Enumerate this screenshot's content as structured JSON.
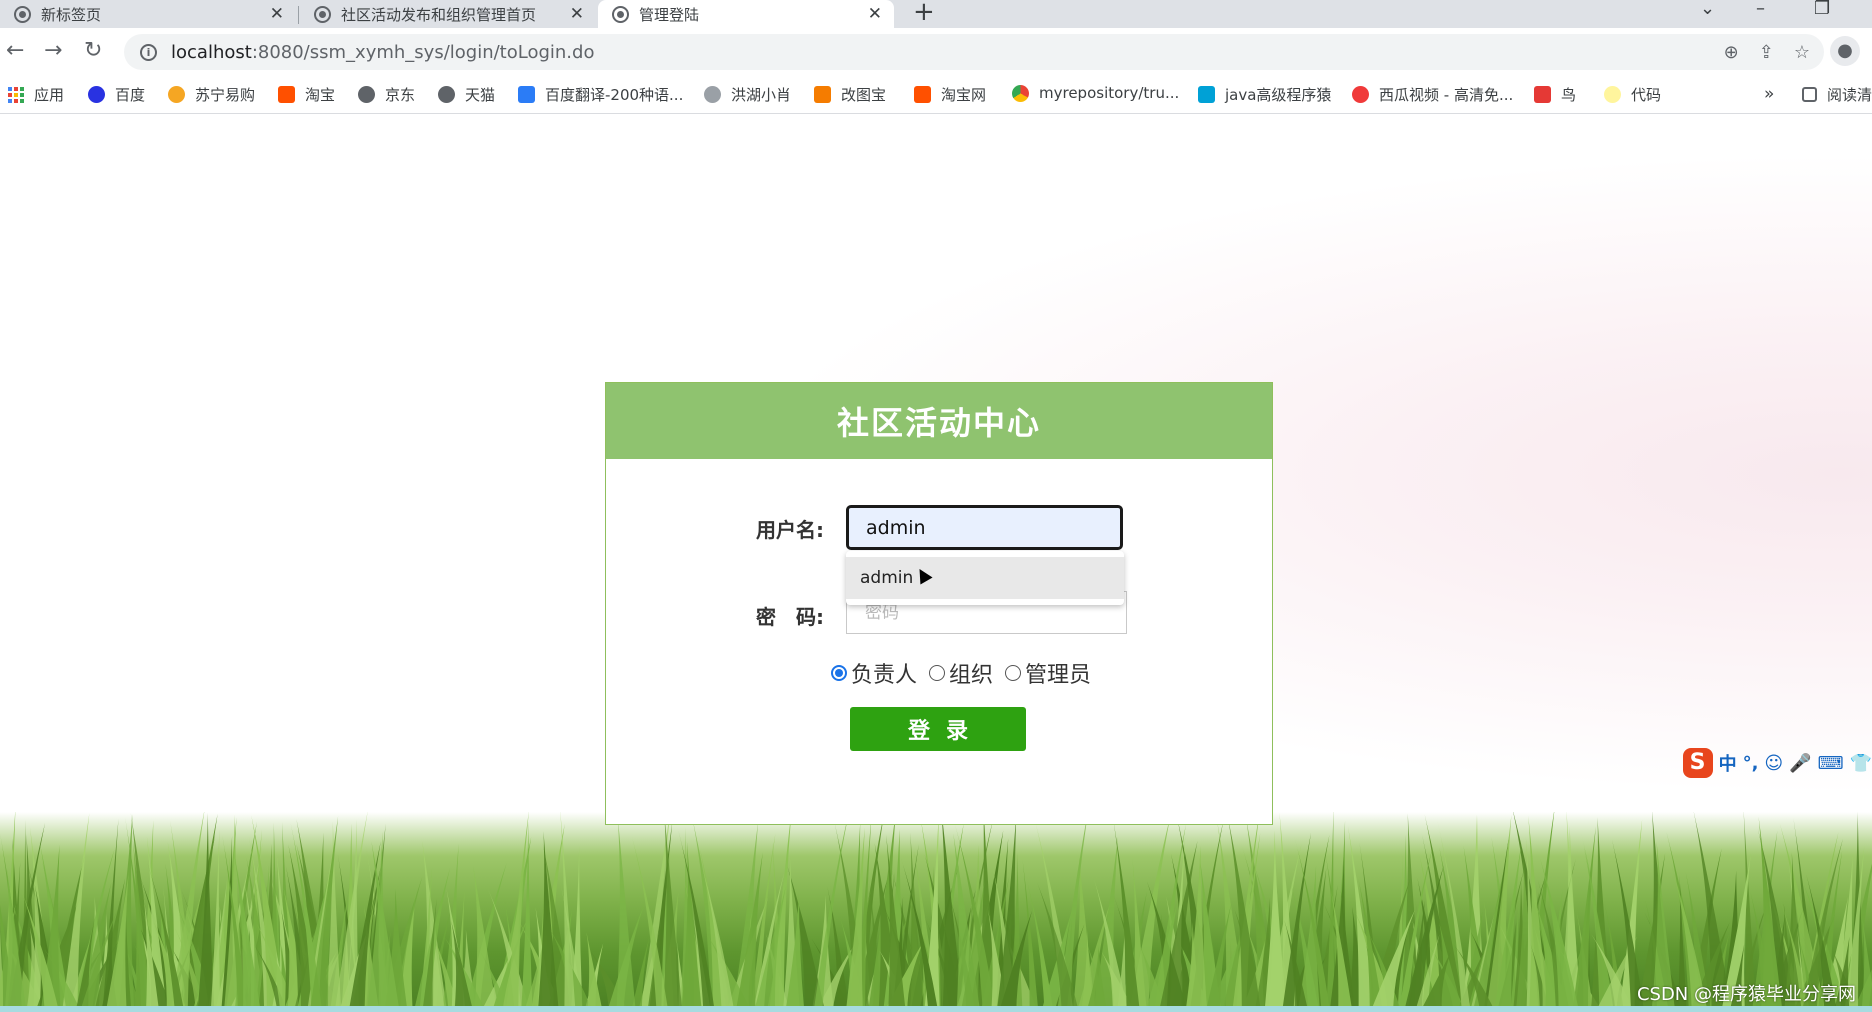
{
  "browser": {
    "tabs": [
      {
        "title": "新标签页",
        "active": false
      },
      {
        "title": "社区活动发布和组织管理首页",
        "active": false
      },
      {
        "title": "管理登陆",
        "active": true
      }
    ],
    "new_tab": "+",
    "url_host": "localhost",
    "url_rest": ":8080/ssm_xymh_sys/login/toLogin.do",
    "bookmarks": [
      {
        "label": "应用",
        "icon": "apps-grid-icon"
      },
      {
        "label": "百度",
        "icon": "baidu-icon"
      },
      {
        "label": "苏宁易购",
        "icon": "suning-icon"
      },
      {
        "label": "淘宝",
        "icon": "taobao-icon"
      },
      {
        "label": "京东",
        "icon": "globe-icon"
      },
      {
        "label": "天猫",
        "icon": "globe-icon"
      },
      {
        "label": "百度翻译-200种语...",
        "icon": "baidu-translate-icon"
      },
      {
        "label": "洪湖小肖",
        "icon": "bird-icon"
      },
      {
        "label": "改图宝",
        "icon": "gaitubao-icon"
      },
      {
        "label": "淘宝网",
        "icon": "taobao-icon"
      },
      {
        "label": "myrepository/tru...",
        "icon": "chrome-icon"
      },
      {
        "label": "java高级程序猿",
        "icon": "bilibili-icon"
      },
      {
        "label": "西瓜视频 - 高清免...",
        "icon": "xigua-icon"
      },
      {
        "label": "鸟",
        "icon": "bird-red-icon"
      },
      {
        "label": "代码",
        "icon": "leaf-icon"
      }
    ],
    "more_bookmarks": "»",
    "reading_list": "阅读清"
  },
  "login": {
    "title": "社区活动中心",
    "username_label": "用户名:",
    "username_value": "admin",
    "password_label": "密　码:",
    "password_placeholder": "密码",
    "autocomplete_item": "admin",
    "roles": [
      {
        "label": "负责人",
        "checked": true
      },
      {
        "label": "组织",
        "checked": false
      },
      {
        "label": "管理员",
        "checked": false
      }
    ],
    "submit_label": "登录"
  },
  "ime": {
    "logo": "S",
    "items": [
      "中",
      "°,",
      "☺",
      "🎤",
      "⌨",
      "👕"
    ]
  },
  "watermark": "CSDN @程序猿毕业分享网",
  "colors": {
    "header_green": "#8fc36f",
    "button_green": "#2ea211",
    "radio_blue": "#1a73e8"
  }
}
